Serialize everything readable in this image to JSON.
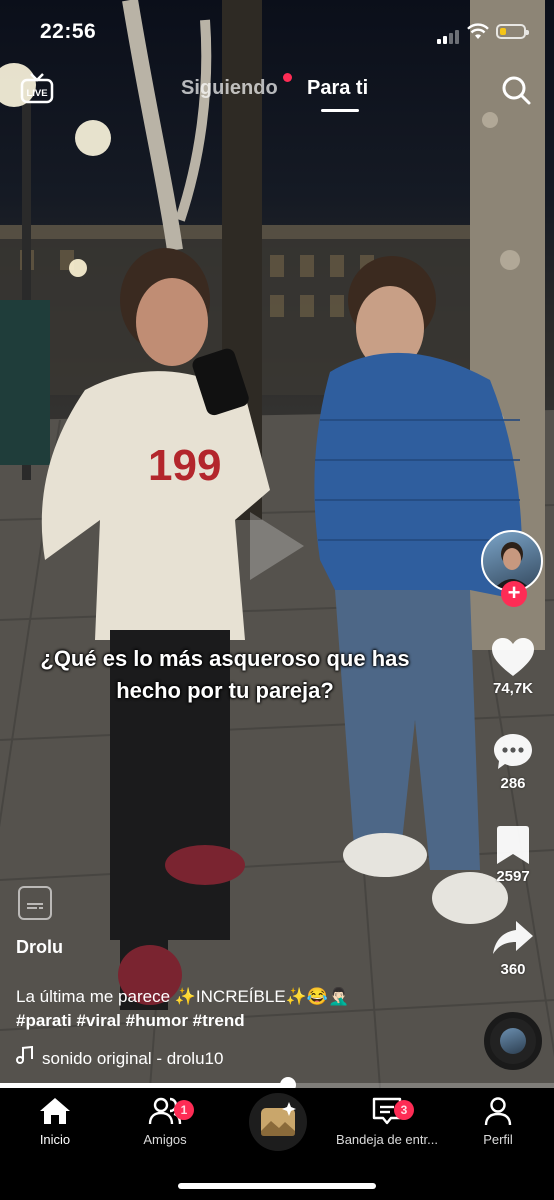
{
  "status_bar": {
    "time": "22:56",
    "battery_level": 0.25
  },
  "top_nav": {
    "tabs": [
      {
        "label": "Siguiendo",
        "has_dot": true
      },
      {
        "label": "Para ti",
        "active": true
      }
    ]
  },
  "caption": {
    "line1": "¿Qué es lo más asqueroso que has",
    "line2": "hecho por tu pareja?"
  },
  "actions": {
    "likes": "74,7K",
    "comments": "286",
    "saves": "2597",
    "shares": "360"
  },
  "post": {
    "username": "Drolu",
    "description": "La última me parece ✨INCREÍBLE✨😂🤦🏻‍♂️",
    "hashtags": "#parati #viral #humor #trend",
    "sound": "sonido original - drolu10"
  },
  "playback": {
    "progress": 0.52
  },
  "bottom_nav": {
    "items": [
      {
        "label": "Inicio",
        "active": true
      },
      {
        "label": "Amigos",
        "badge": "1"
      },
      {
        "label": ""
      },
      {
        "label": "Bandeja de entr...",
        "badge": "3"
      },
      {
        "label": "Perfil"
      }
    ]
  },
  "colors": {
    "accent": "#fe2c55",
    "battery": "#f5c518"
  }
}
